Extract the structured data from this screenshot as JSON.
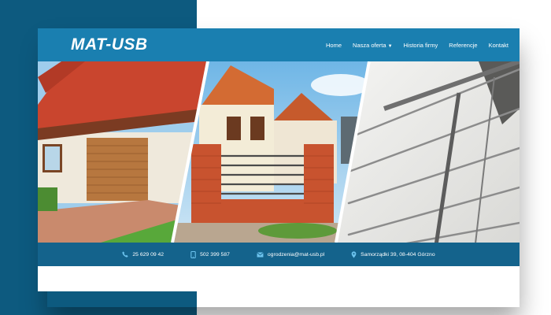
{
  "brand": {
    "logo_text": "MAT-USB"
  },
  "nav": {
    "items": [
      {
        "label": "Home"
      },
      {
        "label": "Nasza oferta",
        "has_dropdown": true
      },
      {
        "label": "Historia firmy"
      },
      {
        "label": "Referencje"
      },
      {
        "label": "Kontakt"
      }
    ]
  },
  "contact": {
    "phone": "25 629 09 42",
    "mobile": "502 399 587",
    "email": "ogrodzenia@mat-usb.pl",
    "address": "Samorządki 39, 08-404 Górzno"
  },
  "icons": {
    "phone": "phone-icon",
    "mobile": "mobile-icon",
    "email": "envelope-icon",
    "address": "map-pin-icon",
    "dropdown": "chevron-down-icon"
  },
  "colors": {
    "nav_bg": "#1a7fb0",
    "contact_bar_bg": "#14638c",
    "icon_accent": "#6cc3ee",
    "backdrop_dark": "#0d5a7f"
  }
}
